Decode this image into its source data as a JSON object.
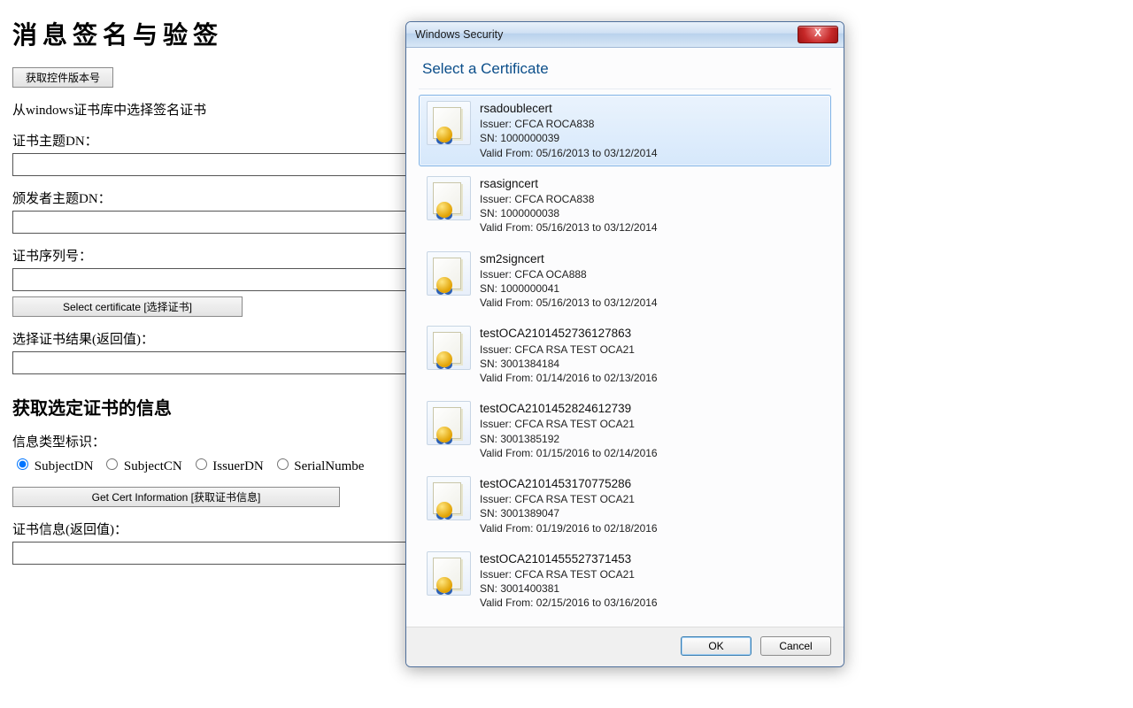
{
  "page": {
    "title": "消息签名与验签",
    "get_version_btn": "获取控件版本号",
    "pick_cert_label": "从windows证书库中选择签名证书",
    "subject_dn_label": "证书主题DN：",
    "issuer_dn_label": "颁发者主题DN：",
    "serial_label": "证书序列号：",
    "select_cert_btn": "Select certificate [选择证书]",
    "select_result_label": "选择证书结果(返回值)：",
    "section_title": "获取选定证书的信息",
    "info_type_label": "信息类型标识：",
    "radio_options": [
      {
        "label": "SubjectDN",
        "checked": true
      },
      {
        "label": "SubjectCN",
        "checked": false
      },
      {
        "label": "IssuerDN",
        "checked": false
      },
      {
        "label": "SerialNumbe",
        "checked": false
      }
    ],
    "get_info_btn": "Get Cert Information [获取证书信息]",
    "cert_info_label": "证书信息(返回值)："
  },
  "dialog": {
    "title": "Windows Security",
    "heading": "Select a Certificate",
    "ok": "OK",
    "cancel": "Cancel",
    "certs": [
      {
        "name": "rsadoublecert",
        "issuer": "CFCA ROCA838",
        "sn": "1000000039",
        "valid": "05/16/2013 to 03/12/2014",
        "selected": true
      },
      {
        "name": "rsasigncert",
        "issuer": "CFCA ROCA838",
        "sn": "1000000038",
        "valid": "05/16/2013 to 03/12/2014",
        "selected": false
      },
      {
        "name": "sm2signcert",
        "issuer": "CFCA OCA888",
        "sn": "1000000041",
        "valid": "05/16/2013 to 03/12/2014",
        "selected": false
      },
      {
        "name": "testOCA2101452736127863",
        "issuer": "CFCA RSA TEST OCA21",
        "sn": "3001384184",
        "valid": "01/14/2016 to 02/13/2016",
        "selected": false
      },
      {
        "name": "testOCA2101452824612739",
        "issuer": "CFCA RSA TEST OCA21",
        "sn": "3001385192",
        "valid": "01/15/2016 to 02/14/2016",
        "selected": false
      },
      {
        "name": "testOCA2101453170775286",
        "issuer": "CFCA RSA TEST OCA21",
        "sn": "3001389047",
        "valid": "01/19/2016 to 02/18/2016",
        "selected": false
      },
      {
        "name": "testOCA2101455527371453",
        "issuer": "CFCA RSA TEST OCA21",
        "sn": "3001400381",
        "valid": "02/15/2016 to 03/16/2016",
        "selected": false
      }
    ]
  }
}
